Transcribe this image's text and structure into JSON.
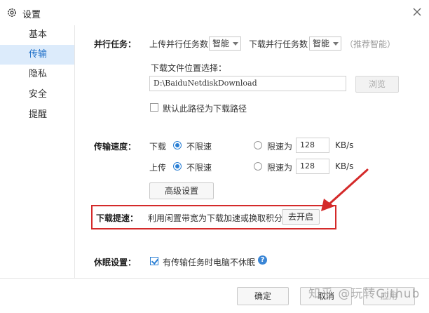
{
  "window": {
    "title": "设置",
    "icon": "gear-icon",
    "close_icon": "close-icon"
  },
  "sidebar": {
    "items": [
      {
        "label": "基本",
        "active": false
      },
      {
        "label": "传输",
        "active": true
      },
      {
        "label": "隐私",
        "active": false
      },
      {
        "label": "安全",
        "active": false
      },
      {
        "label": "提醒",
        "active": false
      }
    ]
  },
  "parallel": {
    "label": "并行任务：",
    "upload_label": "上传并行任务数",
    "upload_value": "智能",
    "download_label": "下载并行任务数",
    "download_value": "智能",
    "hint": "（推荐智能）"
  },
  "download_path": {
    "label": "下载文件位置选择：",
    "value": "D:\\BaiduNetdiskDownload",
    "browse": "浏览",
    "default_checkbox": "默认此路径为下载路径",
    "default_checked": false
  },
  "speed": {
    "label": "传输速度：",
    "download_label": "下载",
    "upload_label": "上传",
    "unlimited": "不限速",
    "limit_to": "限速为",
    "download_limit": "128",
    "upload_limit": "128",
    "unit": "KB/s",
    "advanced_button": "高级设置"
  },
  "boost": {
    "label": "下载提速：",
    "text": "利用闲置带宽为下载加速或换取积分",
    "button": "去开启"
  },
  "sleep": {
    "label": "休眠设置：",
    "checkbox": "有传输任务时电脑不休眠",
    "checked": true
  },
  "footer": {
    "ok": "确定",
    "cancel": "取消",
    "apply": "应用"
  },
  "watermark": "知乎 @玩转Github",
  "colors": {
    "accent": "#2a7fd4",
    "sidebar_active_bg": "#dcebfb",
    "annotation": "#d42a2a"
  }
}
